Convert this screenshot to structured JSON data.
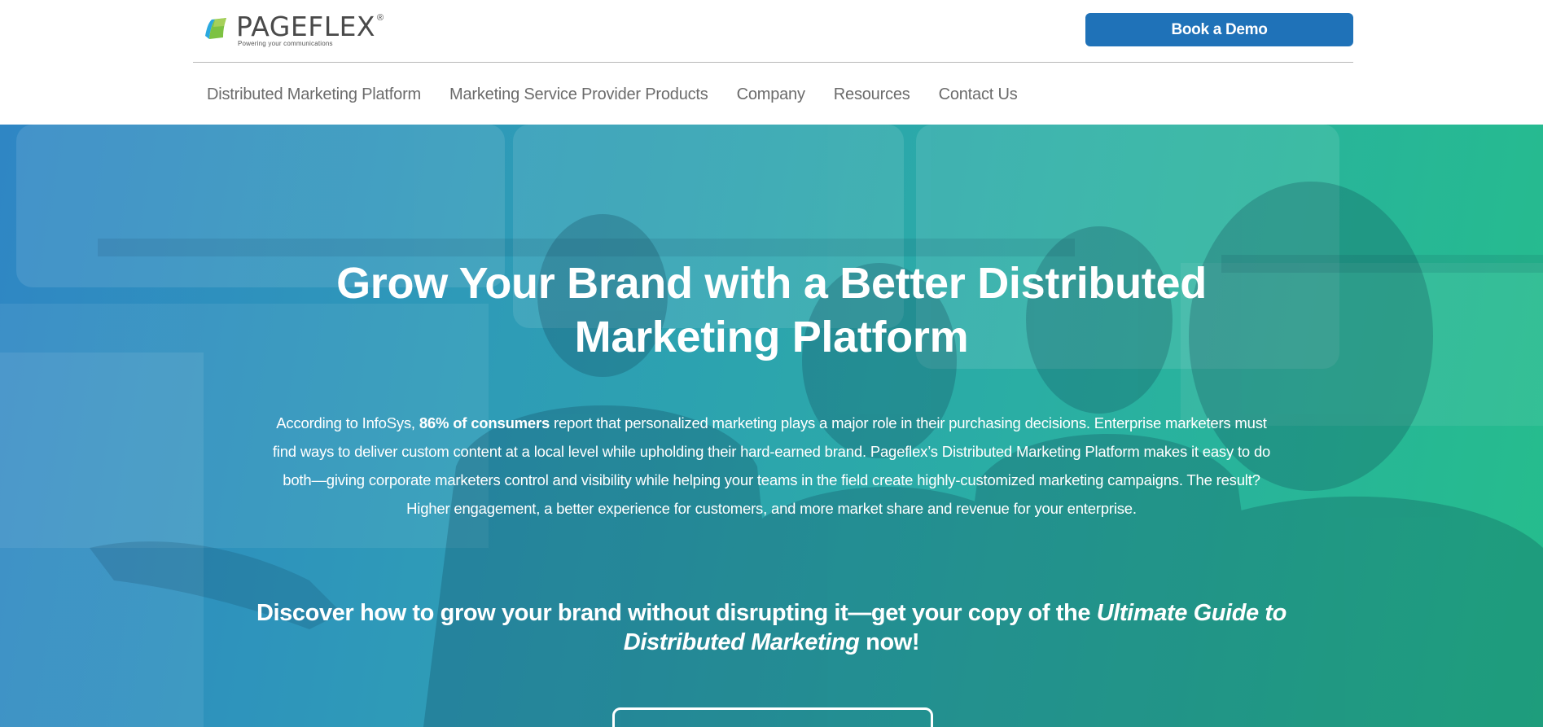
{
  "brand": {
    "name": "PAGEFLEX",
    "registered": "®",
    "tagline": "Powering your communications",
    "logo_icon": "pageflex-logo-icon",
    "logo_colors": [
      "#1f72b8",
      "#7dc242",
      "#2aa9df"
    ]
  },
  "header": {
    "demo_label": "Book a Demo",
    "demo_color": "#1f72b8"
  },
  "nav": {
    "items": [
      {
        "label": "Distributed Marketing Platform"
      },
      {
        "label": "Marketing Service Provider Products"
      },
      {
        "label": "Company"
      },
      {
        "label": "Resources"
      },
      {
        "label": "Contact Us"
      }
    ]
  },
  "hero": {
    "title": "Grow Your Brand with a Better Distributed Marketing Platform",
    "body_lead": "According to InfoSys, ",
    "body_bold": "86% of consumers",
    "body_rest": " report that personalized marketing plays a major role in their purchasing decisions. Enterprise marketers must find ways to deliver custom content at a local level while upholding their hard-earned brand. Pageflex’s Distributed Marketing Platform makes it easy to do both—giving corporate marketers control and visibility while helping your teams in the field create highly-customized marketing campaigns. The result? Higher engagement, a better experience for customers, and more market share and revenue for your enterprise.",
    "cta_lead": "Discover how to grow your brand without disrupting it—get your copy of the ",
    "cta_italic": "Ultimate Guide to Distributed Marketing",
    "cta_tail": " now!",
    "gradient_colors": [
      "#2f86c4",
      "#25bd8c"
    ]
  }
}
